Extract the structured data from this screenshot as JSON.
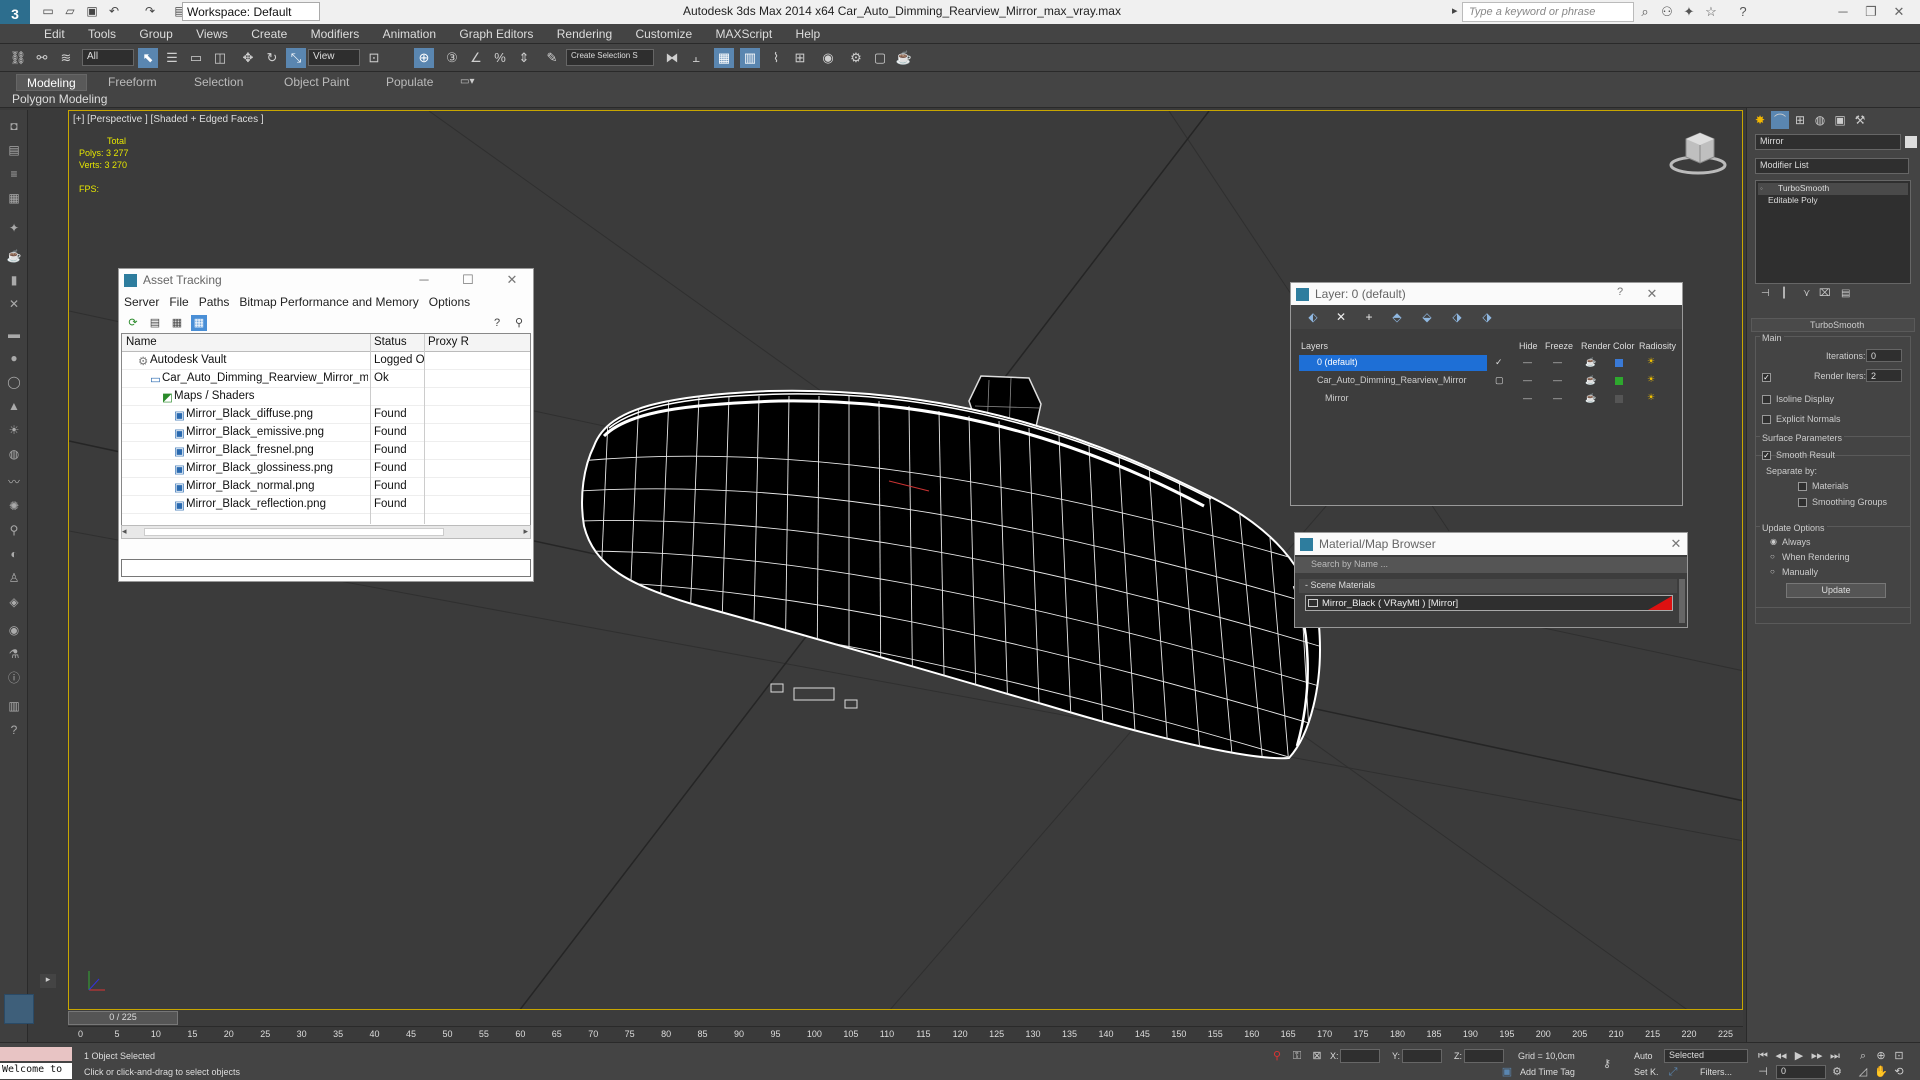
{
  "titlebar": {
    "workspace": "Workspace: Default",
    "title": "Autodesk 3ds Max  2014 x64     Car_Auto_Dimming_Rearview_Mirror_max_vray.max",
    "search_placeholder": "Type a keyword or phrase"
  },
  "menubar": [
    "Edit",
    "Tools",
    "Group",
    "Views",
    "Create",
    "Modifiers",
    "Animation",
    "Graph Editors",
    "Rendering",
    "Customize",
    "MAXScript",
    "Help"
  ],
  "toolbar": {
    "filter_select": "All",
    "view_select": "View",
    "selection_set": "Create Selection S"
  },
  "ribbon": {
    "tabs": [
      "Modeling",
      "Freeform",
      "Selection",
      "Object Paint",
      "Populate"
    ],
    "active_tab": "Modeling",
    "sub_label": "Polygon Modeling"
  },
  "viewport": {
    "label": "[+] [Perspective ] [Shaded + Edged Faces ]",
    "stats": {
      "total": "Total",
      "polys_label": "Polys:",
      "polys": "3 277",
      "verts_label": "Verts:",
      "verts": "3 270",
      "fps_label": "FPS:"
    }
  },
  "asset_tracking": {
    "title": "Asset Tracking",
    "menu": [
      "Server",
      "File",
      "Paths",
      "Bitmap Performance and Memory",
      "Options"
    ],
    "columns": [
      "Name",
      "Status",
      "Proxy R"
    ],
    "rows": [
      {
        "name": "Autodesk Vault",
        "status": "Logged O...",
        "indent": 0,
        "icon": "vault-icon"
      },
      {
        "name": "Car_Auto_Dimming_Rearview_Mirror_max_vray.max",
        "status": "Ok",
        "indent": 1,
        "icon": "file-icon"
      },
      {
        "name": "Maps / Shaders",
        "status": "",
        "indent": 2,
        "icon": "maps-icon"
      },
      {
        "name": "Mirror_Black_diffuse.png",
        "status": "Found",
        "indent": 3,
        "icon": "image-icon"
      },
      {
        "name": "Mirror_Black_emissive.png",
        "status": "Found",
        "indent": 3,
        "icon": "image-icon"
      },
      {
        "name": "Mirror_Black_fresnel.png",
        "status": "Found",
        "indent": 3,
        "icon": "image-icon"
      },
      {
        "name": "Mirror_Black_glossiness.png",
        "status": "Found",
        "indent": 3,
        "icon": "image-icon"
      },
      {
        "name": "Mirror_Black_normal.png",
        "status": "Found",
        "indent": 3,
        "icon": "image-icon"
      },
      {
        "name": "Mirror_Black_reflection.png",
        "status": "Found",
        "indent": 3,
        "icon": "image-icon"
      }
    ]
  },
  "layer_window": {
    "title": "Layer: 0 (default)",
    "columns": [
      "Layers",
      "Hide",
      "Freeze",
      "Render",
      "Color",
      "Radiosity"
    ],
    "rows": [
      {
        "name": "0 (default)",
        "selected": true,
        "color": "#3a7ad6"
      },
      {
        "name": "Car_Auto_Dimming_Rearview_Mirror",
        "selected": false,
        "color": "#2ea82e"
      },
      {
        "name": "Mirror",
        "selected": false,
        "color": "#555555"
      }
    ]
  },
  "material_browser": {
    "title": "Material/Map Browser",
    "search_placeholder": "Search by Name ...",
    "section": "- Scene Materials",
    "item": "Mirror_Black  ( VRayMtl )  [Mirror]"
  },
  "command_panel": {
    "object_name": "Mirror",
    "modifier_list": "Modifier List",
    "stack": [
      "TurboSmooth",
      "Editable Poly"
    ],
    "rollout_title": "TurboSmooth",
    "main_label": "Main",
    "iterations_label": "Iterations:",
    "iterations": "0",
    "render_iters_label": "Render Iters:",
    "render_iters": "2",
    "isoline": "Isoline Display",
    "explicit": "Explicit Normals",
    "surface_params": "Surface Parameters",
    "smooth_result": "Smooth Result",
    "separate_by": "Separate by:",
    "materials": "Materials",
    "smoothing_groups": "Smoothing Groups",
    "update_options": "Update Options",
    "always": "Always",
    "when_rendering": "When Rendering",
    "manually": "Manually",
    "update_btn": "Update"
  },
  "timeline": {
    "slider": "0 / 225",
    "ticks": [
      "0",
      "5",
      "10",
      "15",
      "20",
      "25",
      "30",
      "35",
      "40",
      "45",
      "50",
      "55",
      "60",
      "65",
      "70",
      "75",
      "80",
      "85",
      "90",
      "95",
      "100",
      "105",
      "110",
      "115",
      "120",
      "125",
      "130",
      "135",
      "140",
      "145",
      "150",
      "155",
      "160",
      "165",
      "170",
      "175",
      "180",
      "185",
      "190",
      "195",
      "200",
      "205",
      "210",
      "215",
      "220",
      "225"
    ]
  },
  "statusbar": {
    "maxscript": "Welcome to",
    "objects_selected": "1 Object Selected",
    "prompt": "Click or click-and-drag to select objects",
    "x_label": "X:",
    "y_label": "Y:",
    "z_label": "Z:",
    "grid": "Grid = 10,0cm",
    "add_time_tag": "Add Time Tag",
    "auto": "Auto",
    "set_key": "Set K.",
    "selected": "Selected",
    "filters": "Filters...",
    "frame": "0"
  }
}
